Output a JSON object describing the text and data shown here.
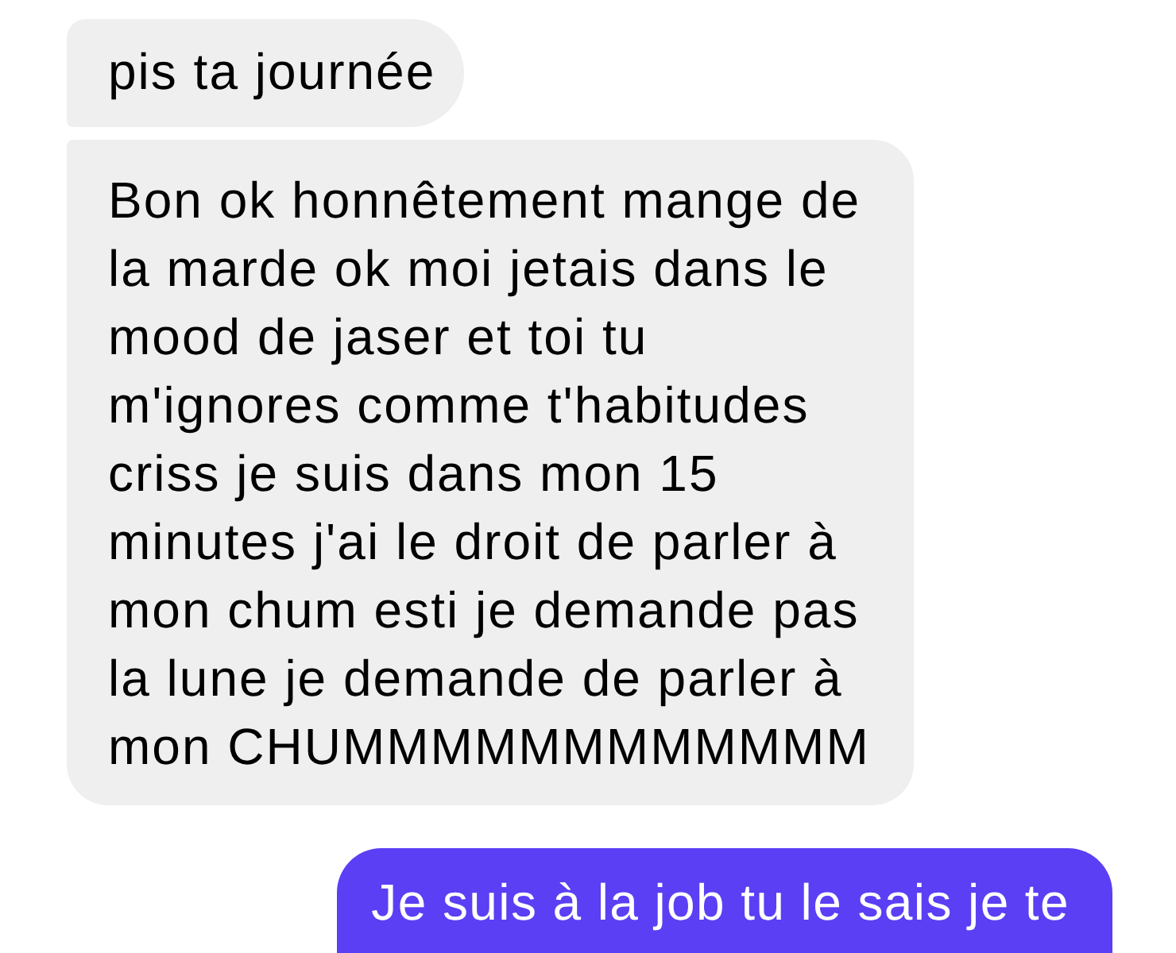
{
  "messages": [
    {
      "kind": "received",
      "text": "pis ta journée"
    },
    {
      "kind": "received",
      "text": "Bon ok honnêtement mange de la marde ok moi jetais dans le mood de jaser et toi tu m'ignores comme t'habitudes criss je suis dans mon 15 minutes j'ai le droit de parler à mon chum esti je demande pas la lune je demande de parler à mon CHUMMMMMMMMMMMM"
    },
    {
      "kind": "sent",
      "text": "Je suis à la job tu le sais je te"
    }
  ]
}
